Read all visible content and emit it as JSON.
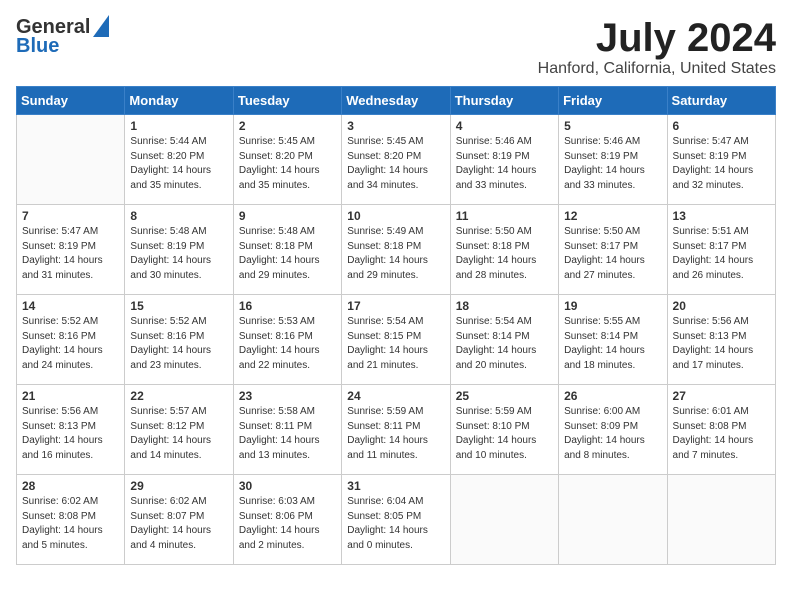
{
  "logo": {
    "general": "General",
    "blue": "Blue"
  },
  "title": "July 2024",
  "subtitle": "Hanford, California, United States",
  "days_of_week": [
    "Sunday",
    "Monday",
    "Tuesday",
    "Wednesday",
    "Thursday",
    "Friday",
    "Saturday"
  ],
  "weeks": [
    [
      {
        "day": "",
        "info": ""
      },
      {
        "day": "1",
        "info": "Sunrise: 5:44 AM\nSunset: 8:20 PM\nDaylight: 14 hours\nand 35 minutes."
      },
      {
        "day": "2",
        "info": "Sunrise: 5:45 AM\nSunset: 8:20 PM\nDaylight: 14 hours\nand 35 minutes."
      },
      {
        "day": "3",
        "info": "Sunrise: 5:45 AM\nSunset: 8:20 PM\nDaylight: 14 hours\nand 34 minutes."
      },
      {
        "day": "4",
        "info": "Sunrise: 5:46 AM\nSunset: 8:19 PM\nDaylight: 14 hours\nand 33 minutes."
      },
      {
        "day": "5",
        "info": "Sunrise: 5:46 AM\nSunset: 8:19 PM\nDaylight: 14 hours\nand 33 minutes."
      },
      {
        "day": "6",
        "info": "Sunrise: 5:47 AM\nSunset: 8:19 PM\nDaylight: 14 hours\nand 32 minutes."
      }
    ],
    [
      {
        "day": "7",
        "info": "Sunrise: 5:47 AM\nSunset: 8:19 PM\nDaylight: 14 hours\nand 31 minutes."
      },
      {
        "day": "8",
        "info": "Sunrise: 5:48 AM\nSunset: 8:19 PM\nDaylight: 14 hours\nand 30 minutes."
      },
      {
        "day": "9",
        "info": "Sunrise: 5:48 AM\nSunset: 8:18 PM\nDaylight: 14 hours\nand 29 minutes."
      },
      {
        "day": "10",
        "info": "Sunrise: 5:49 AM\nSunset: 8:18 PM\nDaylight: 14 hours\nand 29 minutes."
      },
      {
        "day": "11",
        "info": "Sunrise: 5:50 AM\nSunset: 8:18 PM\nDaylight: 14 hours\nand 28 minutes."
      },
      {
        "day": "12",
        "info": "Sunrise: 5:50 AM\nSunset: 8:17 PM\nDaylight: 14 hours\nand 27 minutes."
      },
      {
        "day": "13",
        "info": "Sunrise: 5:51 AM\nSunset: 8:17 PM\nDaylight: 14 hours\nand 26 minutes."
      }
    ],
    [
      {
        "day": "14",
        "info": "Sunrise: 5:52 AM\nSunset: 8:16 PM\nDaylight: 14 hours\nand 24 minutes."
      },
      {
        "day": "15",
        "info": "Sunrise: 5:52 AM\nSunset: 8:16 PM\nDaylight: 14 hours\nand 23 minutes."
      },
      {
        "day": "16",
        "info": "Sunrise: 5:53 AM\nSunset: 8:16 PM\nDaylight: 14 hours\nand 22 minutes."
      },
      {
        "day": "17",
        "info": "Sunrise: 5:54 AM\nSunset: 8:15 PM\nDaylight: 14 hours\nand 21 minutes."
      },
      {
        "day": "18",
        "info": "Sunrise: 5:54 AM\nSunset: 8:14 PM\nDaylight: 14 hours\nand 20 minutes."
      },
      {
        "day": "19",
        "info": "Sunrise: 5:55 AM\nSunset: 8:14 PM\nDaylight: 14 hours\nand 18 minutes."
      },
      {
        "day": "20",
        "info": "Sunrise: 5:56 AM\nSunset: 8:13 PM\nDaylight: 14 hours\nand 17 minutes."
      }
    ],
    [
      {
        "day": "21",
        "info": "Sunrise: 5:56 AM\nSunset: 8:13 PM\nDaylight: 14 hours\nand 16 minutes."
      },
      {
        "day": "22",
        "info": "Sunrise: 5:57 AM\nSunset: 8:12 PM\nDaylight: 14 hours\nand 14 minutes."
      },
      {
        "day": "23",
        "info": "Sunrise: 5:58 AM\nSunset: 8:11 PM\nDaylight: 14 hours\nand 13 minutes."
      },
      {
        "day": "24",
        "info": "Sunrise: 5:59 AM\nSunset: 8:11 PM\nDaylight: 14 hours\nand 11 minutes."
      },
      {
        "day": "25",
        "info": "Sunrise: 5:59 AM\nSunset: 8:10 PM\nDaylight: 14 hours\nand 10 minutes."
      },
      {
        "day": "26",
        "info": "Sunrise: 6:00 AM\nSunset: 8:09 PM\nDaylight: 14 hours\nand 8 minutes."
      },
      {
        "day": "27",
        "info": "Sunrise: 6:01 AM\nSunset: 8:08 PM\nDaylight: 14 hours\nand 7 minutes."
      }
    ],
    [
      {
        "day": "28",
        "info": "Sunrise: 6:02 AM\nSunset: 8:08 PM\nDaylight: 14 hours\nand 5 minutes."
      },
      {
        "day": "29",
        "info": "Sunrise: 6:02 AM\nSunset: 8:07 PM\nDaylight: 14 hours\nand 4 minutes."
      },
      {
        "day": "30",
        "info": "Sunrise: 6:03 AM\nSunset: 8:06 PM\nDaylight: 14 hours\nand 2 minutes."
      },
      {
        "day": "31",
        "info": "Sunrise: 6:04 AM\nSunset: 8:05 PM\nDaylight: 14 hours\nand 0 minutes."
      },
      {
        "day": "",
        "info": ""
      },
      {
        "day": "",
        "info": ""
      },
      {
        "day": "",
        "info": ""
      }
    ]
  ]
}
